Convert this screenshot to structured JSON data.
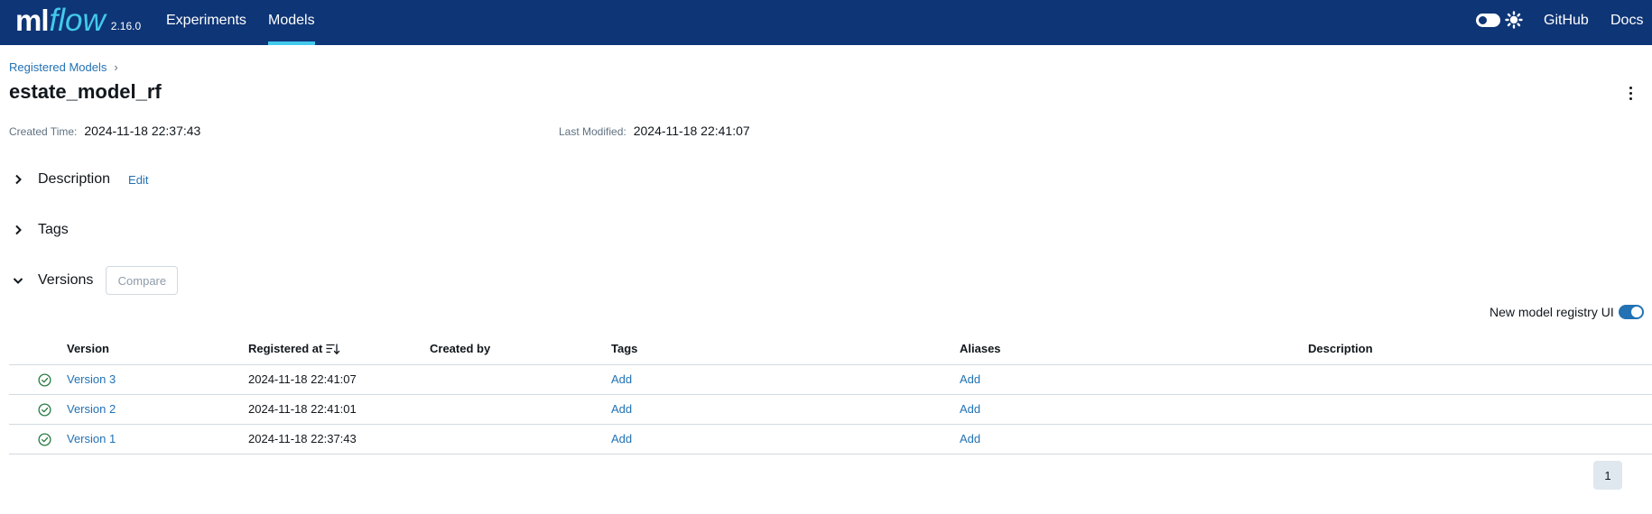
{
  "header": {
    "logo_ml": "ml",
    "logo_flow": "flow",
    "version": "2.16.0",
    "tabs": [
      {
        "label": "Experiments",
        "active": false
      },
      {
        "label": "Models",
        "active": true
      }
    ],
    "links": {
      "github": "GitHub",
      "docs": "Docs"
    },
    "theme_toggle": {
      "state": "off",
      "icon": "sun-icon"
    }
  },
  "breadcrumb": {
    "parent": "Registered Models",
    "separator": "›"
  },
  "page": {
    "title": "estate_model_rf",
    "created_label": "Created Time:",
    "created_value": "2024-11-18 22:37:43",
    "modified_label": "Last Modified:",
    "modified_value": "2024-11-18 22:41:07"
  },
  "sections": {
    "description": {
      "title": "Description",
      "edit": "Edit",
      "expanded": false
    },
    "tags": {
      "title": "Tags",
      "expanded": false
    },
    "versions": {
      "title": "Versions",
      "compare": "Compare",
      "expanded": true
    }
  },
  "registry_toggle": {
    "label": "New model registry UI",
    "on": true
  },
  "table": {
    "columns": [
      "Version",
      "Registered at",
      "Created by",
      "Tags",
      "Aliases",
      "Description"
    ],
    "rows": [
      {
        "version": "Version 3",
        "registered_at": "2024-11-18 22:41:07",
        "created_by": "",
        "tags": "Add",
        "aliases": "Add",
        "description": "",
        "status": "ready"
      },
      {
        "version": "Version 2",
        "registered_at": "2024-11-18 22:41:01",
        "created_by": "",
        "tags": "Add",
        "aliases": "Add",
        "description": "",
        "status": "ready"
      },
      {
        "version": "Version 1",
        "registered_at": "2024-11-18 22:37:43",
        "created_by": "",
        "tags": "Add",
        "aliases": "Add",
        "description": "",
        "status": "ready"
      }
    ]
  },
  "pagination": {
    "current_page": "1"
  },
  "colors": {
    "header_bg": "#0e3576",
    "accent": "#43c9ed",
    "link": "#2272b4",
    "success": "#277c43"
  }
}
